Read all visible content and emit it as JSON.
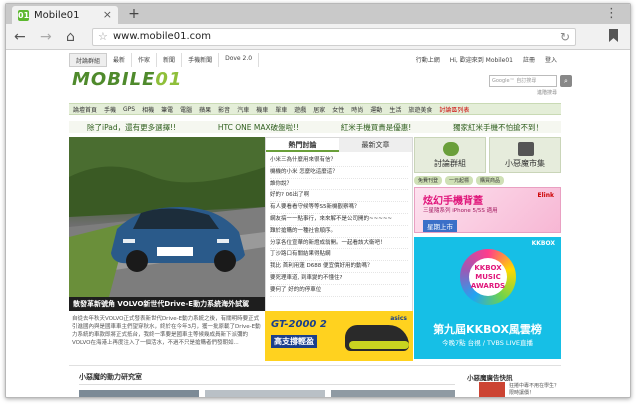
{
  "browser": {
    "tab_title": "Mobile01",
    "tab_favicon": "01",
    "url": "www.mobile01.com",
    "new_tab": "+",
    "close_tab": "×"
  },
  "site": {
    "logo_main": "MOBILE",
    "logo_accent": "01",
    "top_nav": [
      "討論群組",
      "最新",
      "作家",
      "新聞",
      "手機新聞",
      "Dove 2.0"
    ],
    "top_links": [
      "行動上網",
      "Hi, 歡迎來到 Mobile01",
      "註冊",
      "登入"
    ],
    "search_placeholder": "Google™ 自訂搜尋",
    "search_button": "⌕",
    "advanced_search": "進階搜尋",
    "categories": [
      "論壇首頁",
      "手機",
      "GPS",
      "相機",
      "筆電",
      "電腦",
      "蘋果",
      "影音",
      "汽車",
      "機車",
      "單車",
      "遊戲",
      "居家",
      "女性",
      "時尚",
      "運動",
      "生活",
      "旅遊美食",
      "討論區列表"
    ],
    "marquee": [
      "除了iPad，還有更多選擇!!",
      "HTC ONE MAX破盤啦!!",
      "紅米手機買貴是優惠!",
      "獨家紅米手機不怕搶不到！"
    ],
    "feature": {
      "caption": "散發革新號角 VOLVO新世代Drive-E動力系統海外試駕",
      "plate": "N麗 377",
      "desc": "自從去年秋天VOLVO正式發表新世代Drive-E動力系統之後，有關明時要正式引進國內與是國車車主們望穿秋水，終於在今年3月，獲一批原載了Drive-E動力系統的車款即將正式抵台，我終一準要是國車主等候幾成員新下派彌的VOLVO在海港上再度注入了一個活水，不過不只是搶購者們發朝如..."
    },
    "hot": {
      "tab_hot": "熱門討論",
      "tab_new": "最新文章",
      "items": [
        "小米三為什麼用來很有信？",
        "機機的小米 怎麼吃這麼這？",
        "誰你說？",
        "好的? 06出了啊",
        "有人要看看守候等等S5新機觀察嗎？",
        "網友搞一一點事行，來來解不是公司開的~~~~~",
        "難於搶購的一種社會順序。",
        "分享各位宣華的新燈成翁開。一起看該大衛吧！",
        "丁沙路口有關結果得貼網",
        "我比 首利用蓮 D688 便宜價好用的動嗎？",
        "要死理車道, 到車變的不懂住?",
        "要何了 好的的停車位"
      ],
      "more": "more"
    },
    "right": {
      "forum_group": "討論群組",
      "market": "小惡魔市集",
      "pills": [
        "免費刊登",
        "一元起標",
        "購買商品"
      ],
      "ad_title": "炫幻手機背蓋",
      "ad_sub": "三星隨系列 iPhone 5/5S 適用",
      "ad_button": "星期上市",
      "ad_brand": "Elink",
      "kkbox_brand": "KKBOX",
      "kkbox_ring": "KKBOX MUSIC AWARDS",
      "kkbox_title": "第九屆KKBOX風雲榜",
      "kkbox_sub": "今晚7點 台視 / TVBS LIVE直播"
    },
    "asics": {
      "title": "GT-2000 2",
      "sub": "高支撐輕盈",
      "brand": "asics"
    },
    "bottom": {
      "left_heading": "小惡魔的動力研究室",
      "right_heading": "小惡魔廣告快訊",
      "right_text": "狂捲中專不用在學生？限時讓價！"
    }
  }
}
